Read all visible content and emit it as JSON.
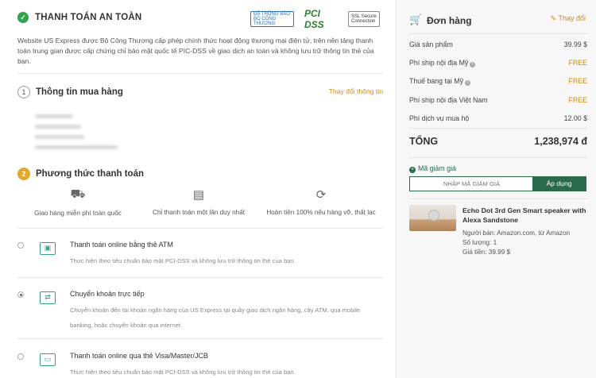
{
  "checkout": {
    "safe_title": "THANH TOÁN AN TOÀN",
    "badges": [
      "ĐÃ THÔNG BÁO BỘ CÔNG THƯƠNG",
      "PCI DSS",
      "SSL Secure Connection"
    ],
    "safe_desc": "Website US Express được Bộ Công Thương cấp phép chính thức hoạt động thương mại điện tử, trên nền tảng thanh toán trung gian được cấp chứng chỉ bảo mật quốc tế PIC-DSS về giao dịch an toàn và không lưu trữ thông tin thẻ của bạn.",
    "buyer_section": {
      "number": "1",
      "title": "Thông tin mua hàng",
      "change_label": "Thay đổi thông tin"
    },
    "payment_section": {
      "number": "2",
      "title": "Phương thức thanh toán"
    },
    "features": [
      {
        "icon": "truck-icon",
        "label": "Giao hàng miễn phí toàn quốc"
      },
      {
        "icon": "document-icon",
        "label": "Chỉ thanh toán một lần duy nhất"
      },
      {
        "icon": "refund-icon",
        "label": "Hoàn tiền 100% nếu hàng vỡ, thất lạc"
      }
    ],
    "methods": [
      {
        "title": "Thanh toán online bằng thẻ ATM",
        "desc": "Thực hiện theo tiêu chuẩn bảo mật PCI-DSS và không lưu trữ thông tin thẻ của bạn.",
        "selected": false
      },
      {
        "title": "Chuyển khoản trực tiếp",
        "desc": "Chuyển khoản đến tài khoản ngân hàng của US Express tại quầy giao dịch ngân hàng, cây ATM, qua mobile banking, hoặc chuyển khoản qua internet.",
        "selected": true
      },
      {
        "title": "Thanh toán online qua thẻ Visa/Master/JCB",
        "desc": "Thực hiện theo tiêu chuẩn bảo mật PCI-DSS và không lưu trữ thông tin thẻ của bạn.",
        "selected": false
      }
    ]
  },
  "order": {
    "title": "Đơn hàng",
    "edit_label": "Thay đổi",
    "rows": [
      {
        "label": "Giá sản phẩm",
        "value": "39.99 $",
        "info": false,
        "free": false
      },
      {
        "label": "Phí ship nội địa Mỹ",
        "value": "FREE",
        "info": true,
        "free": true
      },
      {
        "label": "Thuế bang tại Mỹ",
        "value": "FREE",
        "info": true,
        "free": true
      },
      {
        "label": "Phí ship nội địa Việt Nam",
        "value": "FREE",
        "info": false,
        "free": true
      },
      {
        "label": "Phí dịch vụ mua hộ",
        "value": "12.00 $",
        "info": false,
        "free": false
      }
    ],
    "total_label": "TỔNG",
    "total_value": "1,238,974 đ",
    "coupon_link": "Mã giảm giá",
    "coupon_placeholder": "NHẬP MÃ GIẢM GIÁ",
    "apply_label": "Áp dụng",
    "product": {
      "name": "Echo Dot 3rd Gen Smart speaker with Alexa Sandstone",
      "seller": "Người bán: Amazon.com, từ Amazon",
      "qty": "Số lượng: 1",
      "price": "Giá tiền: 39.99 $"
    }
  },
  "colors": {
    "accent": "#2c6b4a",
    "orange": "#d08a16",
    "check_green": "#2ea44f"
  }
}
